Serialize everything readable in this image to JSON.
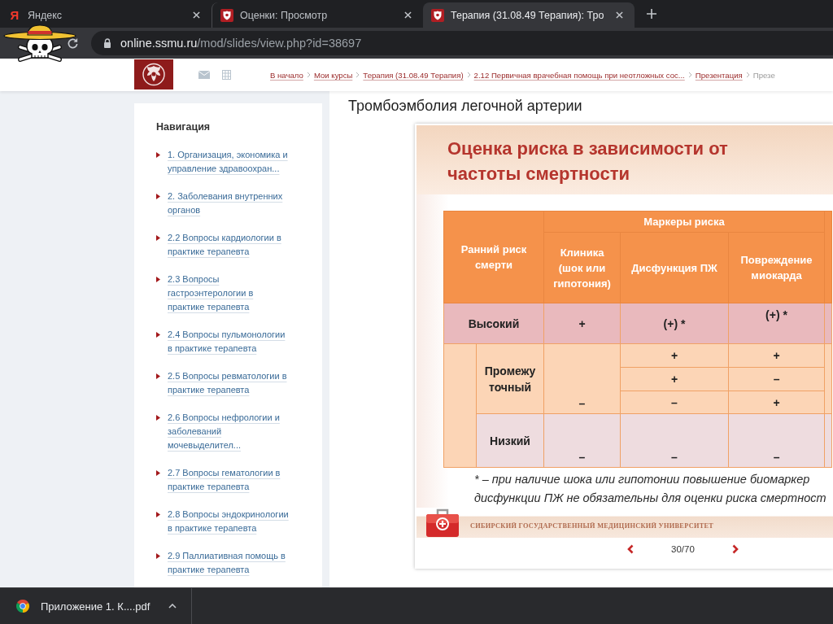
{
  "browser": {
    "tabs": [
      {
        "kind": "yandex",
        "favicon": "Я",
        "title": "Яндекс",
        "selected": false
      },
      {
        "kind": "site",
        "title": "Оценки: Просмотр",
        "selected": false
      },
      {
        "kind": "site",
        "title": "Терапия (31.08.49 Терапия): Тро",
        "selected": true
      }
    ],
    "address": {
      "host": "online.ssmu.ru",
      "path": "/mod/slides/view.php?id=38697"
    }
  },
  "header": {
    "breadcrumbs": [
      "В начало",
      "Мои курсы",
      "Терапия (31.08.49 Терапия)",
      "2.12 Первичная врачебная помощь при неотложных сос...",
      "Презентация",
      "Презе"
    ]
  },
  "sidebar": {
    "title": "Навигация",
    "items": [
      "1. Организация, экономика и управление здравоохран...",
      "2. Заболевания внутренних органов",
      "2.2 Вопросы кардиологии в практике терапевта",
      "2.3 Вопросы гастроэнтерологии в практике терапевта",
      "2.4 Вопросы пульмонологии в практике терапевта",
      "2.5 Вопросы ревматологии в практике терапевта",
      "2.6 Вопросы нефрологии и заболеваний мочевыделител...",
      "2.7 Вопросы гематологии в практике терапевта",
      "2.8 Вопросы эндокринологии в практике терапевта",
      "2.9 Паллиативная помощь в практике терапевта"
    ]
  },
  "content": {
    "title": "Тромбоэмболия легочной артерии",
    "slide": {
      "title": "Оценка риска в зависимости от частоты смертности",
      "table": {
        "row_header": "Ранний риск смерти",
        "group_header": "Маркеры риска",
        "columns": [
          "Клиника (шок или гипотония)",
          "Дисфункция ПЖ",
          "Повреждение миокарда"
        ],
        "rows": [
          {
            "kind": "high",
            "label": "Высокий",
            "cells": [
              "+",
              "(+) *",
              "(+) *"
            ]
          },
          {
            "kind": "intermediate",
            "label": "Промежу точный",
            "clinic": "–",
            "sub_rows": [
              [
                "+",
                "+"
              ],
              [
                "+",
                "–"
              ],
              [
                "–",
                "+"
              ]
            ]
          },
          {
            "kind": "low",
            "label": "Низкий",
            "cells": [
              "–",
              "–",
              "–"
            ]
          }
        ]
      },
      "footnote_lines": [
        "* – при наличие шока или гипотонии повышение биомаркер",
        "дисфункции ПЖ не обязательны для оценки риска смертност"
      ],
      "footer": "СИБИРСКИЙ ГОСУДАРСТВЕННЫЙ МЕДИЦИНСКИЙ УНИВЕРСИТЕТ"
    },
    "pager": "30/70"
  },
  "downloads": [
    {
      "name": "Приложение 1. К....pdf"
    }
  ]
}
